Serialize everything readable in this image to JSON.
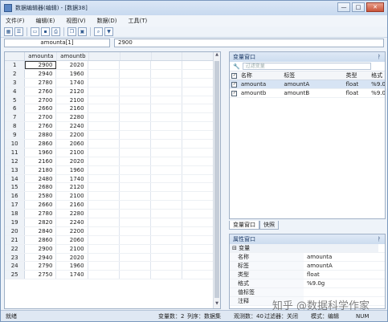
{
  "window": {
    "title": "数据编辑器(编辑) - [数据38]",
    "min": "—",
    "max": "□",
    "close": "✕"
  },
  "menu": [
    "文件(F)",
    "编辑(E)",
    "视图(V)",
    "数据(D)",
    "工具(T)"
  ],
  "editbar": {
    "name": "amounta[1]",
    "value": "2900"
  },
  "grid": {
    "columns": [
      "amounta",
      "amountb"
    ],
    "rows": [
      [
        "1",
        "2900",
        "2020"
      ],
      [
        "2",
        "2940",
        "1960"
      ],
      [
        "3",
        "2780",
        "1740"
      ],
      [
        "4",
        "2760",
        "2120"
      ],
      [
        "5",
        "2700",
        "2100"
      ],
      [
        "6",
        "2660",
        "2160"
      ],
      [
        "7",
        "2700",
        "2280"
      ],
      [
        "8",
        "2760",
        "2240"
      ],
      [
        "9",
        "2880",
        "2200"
      ],
      [
        "10",
        "2860",
        "2060"
      ],
      [
        "11",
        "1960",
        "2100"
      ],
      [
        "12",
        "2160",
        "2020"
      ],
      [
        "13",
        "2180",
        "1960"
      ],
      [
        "14",
        "2480",
        "1740"
      ],
      [
        "15",
        "2680",
        "2120"
      ],
      [
        "16",
        "2580",
        "2100"
      ],
      [
        "17",
        "2660",
        "2160"
      ],
      [
        "18",
        "2780",
        "2280"
      ],
      [
        "19",
        "2820",
        "2240"
      ],
      [
        "20",
        "2840",
        "2200"
      ],
      [
        "21",
        "2860",
        "2060"
      ],
      [
        "22",
        "2900",
        "2100"
      ],
      [
        "23",
        "2940",
        "2020"
      ],
      [
        "24",
        "2790",
        "1960"
      ],
      [
        "25",
        "2750",
        "1740"
      ]
    ]
  },
  "varpanel": {
    "title": "变量窗口",
    "pin": "ᚹ",
    "filter_placeholder": "过滤变量",
    "headers": [
      "名称",
      "标签",
      "类型",
      "格式"
    ],
    "vars": [
      [
        "amounta",
        "amountA",
        "float",
        "%9.0"
      ],
      [
        "amountb",
        "amountB",
        "float",
        "%9.0"
      ]
    ]
  },
  "tabs": [
    "变量窗口",
    "快照"
  ],
  "proppanel": {
    "title": "属性窗口",
    "pin": "ᚹ",
    "group": "变量",
    "props": [
      [
        "名称",
        "amounta"
      ],
      [
        "标签",
        "amountA"
      ],
      [
        "类型",
        "float"
      ],
      [
        "格式",
        "%9.0g"
      ],
      [
        "值标签",
        ""
      ],
      [
        "注释",
        ""
      ]
    ]
  },
  "status": {
    "ready": "就绪",
    "vars": "变量数：2",
    "order": "列序：数据集",
    "obs": "观测数：40",
    "filter": "过滤器：关闭",
    "mode": "模式：编辑",
    "num": "NUM"
  },
  "watermark": "知乎 @数据科学作家"
}
